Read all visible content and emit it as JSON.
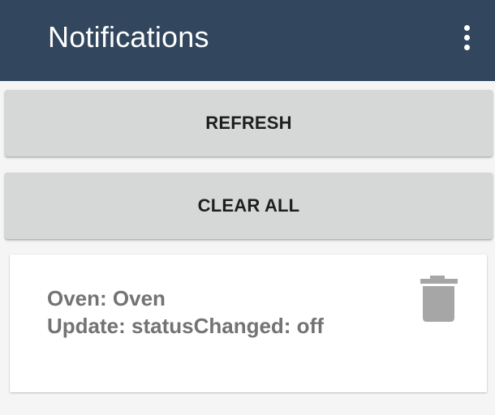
{
  "app_bar": {
    "title": "Notifications",
    "overflow_icon": "more-vert-icon",
    "background_color": "#32475e"
  },
  "buttons": {
    "refresh_label": "REFRESH",
    "clear_all_label": "CLEAR ALL"
  },
  "notifications": [
    {
      "title": "Oven: Oven",
      "message": "Update: statusChanged: off",
      "delete_icon": "trash-icon"
    }
  ]
}
